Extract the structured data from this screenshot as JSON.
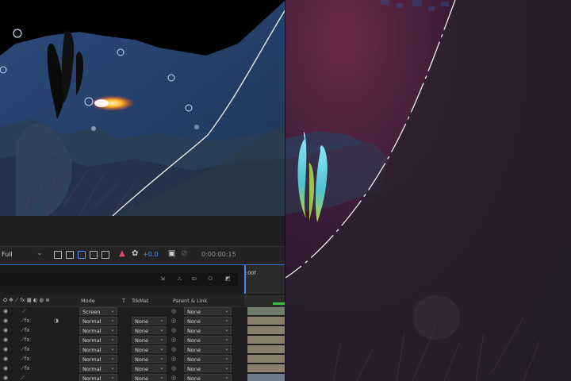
{
  "toolbar": {
    "resolution": "Full",
    "exposure_value": "+0.0",
    "timecode": "0:00:00:15"
  },
  "timeline": {
    "ruler_label": ":00f"
  },
  "layer_panel": {
    "headers": {
      "mode": "Mode",
      "t": "T",
      "trkmat": "TrkMat",
      "parent": "Parent & Link"
    },
    "rows": [
      {
        "mode": "Screen",
        "trkmat": "",
        "parent": "None"
      },
      {
        "mode": "Normal",
        "trkmat": "None",
        "parent": "None"
      },
      {
        "mode": "Normal",
        "trkmat": "None",
        "parent": "None"
      },
      {
        "mode": "Normal",
        "trkmat": "None",
        "parent": "None"
      },
      {
        "mode": "Normal",
        "trkmat": "None",
        "parent": "None"
      },
      {
        "mode": "Normal",
        "trkmat": "None",
        "parent": "None"
      },
      {
        "mode": "Normal",
        "trkmat": "None",
        "parent": "None"
      },
      {
        "mode": "Normal",
        "trkmat": "None",
        "parent": "None"
      }
    ]
  },
  "colors": {
    "accent": "#2a6fd6",
    "exposure": "#3d8bff",
    "track": "#8a7f6a"
  }
}
